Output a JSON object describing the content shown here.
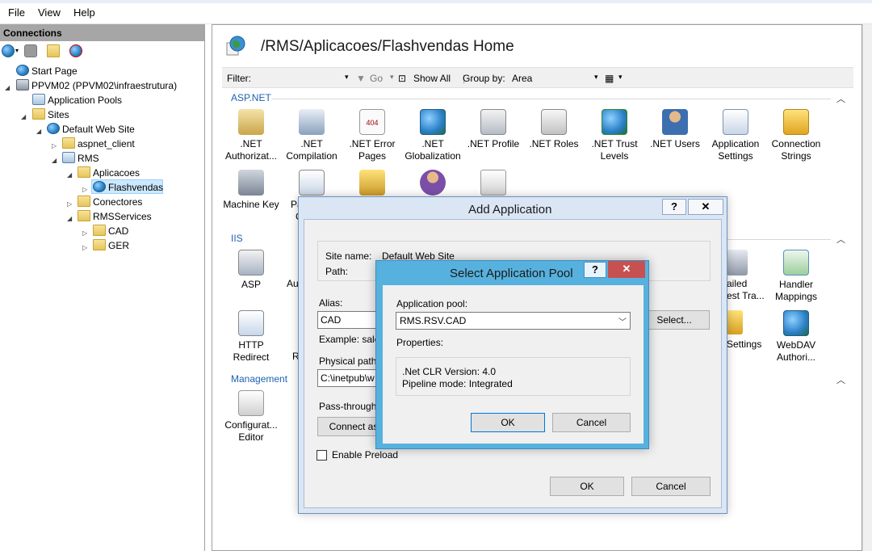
{
  "menu": [
    "File",
    "View",
    "Help"
  ],
  "connections": {
    "title": "Connections",
    "tree": [
      {
        "label": "Start Page"
      },
      {
        "label": "PPVM02 (PPVM02\\infraestrutura)"
      },
      {
        "label": "Application Pools"
      },
      {
        "label": "Sites"
      },
      {
        "label": "Default Web Site"
      },
      {
        "label": "aspnet_client"
      },
      {
        "label": "RMS"
      },
      {
        "label": "Aplicacoes"
      },
      {
        "label": "Flashvendas"
      },
      {
        "label": "Conectores"
      },
      {
        "label": "RMSServices"
      },
      {
        "label": "CAD"
      },
      {
        "label": "GER"
      }
    ]
  },
  "main": {
    "title": "/RMS/Aplicacoes/Flashvendas Home",
    "filter": {
      "label": "Filter:",
      "go": "Go",
      "show_all": "Show All",
      "group_by_label": "Group by:",
      "group_by_value": "Area"
    },
    "sections": {
      "aspnet": "ASP.NET",
      "iis": "IIS",
      "management": "Management"
    },
    "aspnet_features": [
      {
        "l1": ".NET",
        "l2": "Authorizat..."
      },
      {
        "l1": ".NET",
        "l2": "Compilation"
      },
      {
        "l1": ".NET Error",
        "l2": "Pages"
      },
      {
        "l1": ".NET",
        "l2": "Globalization"
      },
      {
        "l1": ".NET Profile",
        "l2": ""
      },
      {
        "l1": ".NET Roles",
        "l2": ""
      },
      {
        "l1": ".NET Trust",
        "l2": "Levels"
      },
      {
        "l1": ".NET Users",
        "l2": ""
      },
      {
        "l1": "Application",
        "l2": "Settings"
      },
      {
        "l1": "Connection",
        "l2": "Strings"
      }
    ],
    "aspnet_row2": [
      {
        "l1": "Machine Key",
        "l2": ""
      },
      {
        "l1": "Pa",
        "l2": "C"
      }
    ],
    "iis_features": [
      {
        "l1": "ASP",
        "l2": ""
      },
      {
        "l1": "Au",
        "l2": ""
      },
      {
        "l1": "ailed",
        "l2": "est Tra..."
      },
      {
        "l1": "Handler",
        "l2": "Mappings"
      },
      {
        "l1": "HTTP",
        "l2": "Redirect"
      },
      {
        "l1": "R",
        "l2": ""
      },
      {
        "l1": "Settings",
        "l2": ""
      },
      {
        "l1": "WebDAV",
        "l2": "Authori..."
      }
    ],
    "management_features": [
      {
        "l1": "Configurat...",
        "l2": "Editor"
      }
    ]
  },
  "add_application": {
    "title": "Add Application",
    "help": "?",
    "close": "✕",
    "site_name_label": "Site name:",
    "site_name_value": "Default Web Site",
    "path_label": "Path:",
    "alias_label": "Alias:",
    "alias_value": "CAD",
    "example_label": "Example: sales",
    "physical_path_label": "Physical path:",
    "physical_path_value": "C:\\inetpub\\w",
    "pass_through_label": "Pass-through",
    "connect_as": "Connect as...",
    "select_button": "Select...",
    "enable_preload": "Enable Preload",
    "ok": "OK",
    "cancel": "Cancel"
  },
  "select_pool": {
    "title": "Select Application Pool",
    "help": "?",
    "close": "✕",
    "pool_label": "Application pool:",
    "pool_value": "RMS.RSV.CAD",
    "properties_label": "Properties:",
    "clr_version": ".Net CLR Version: 4.0",
    "pipeline_mode": "Pipeline mode: Integrated",
    "ok": "OK",
    "cancel": "Cancel"
  }
}
